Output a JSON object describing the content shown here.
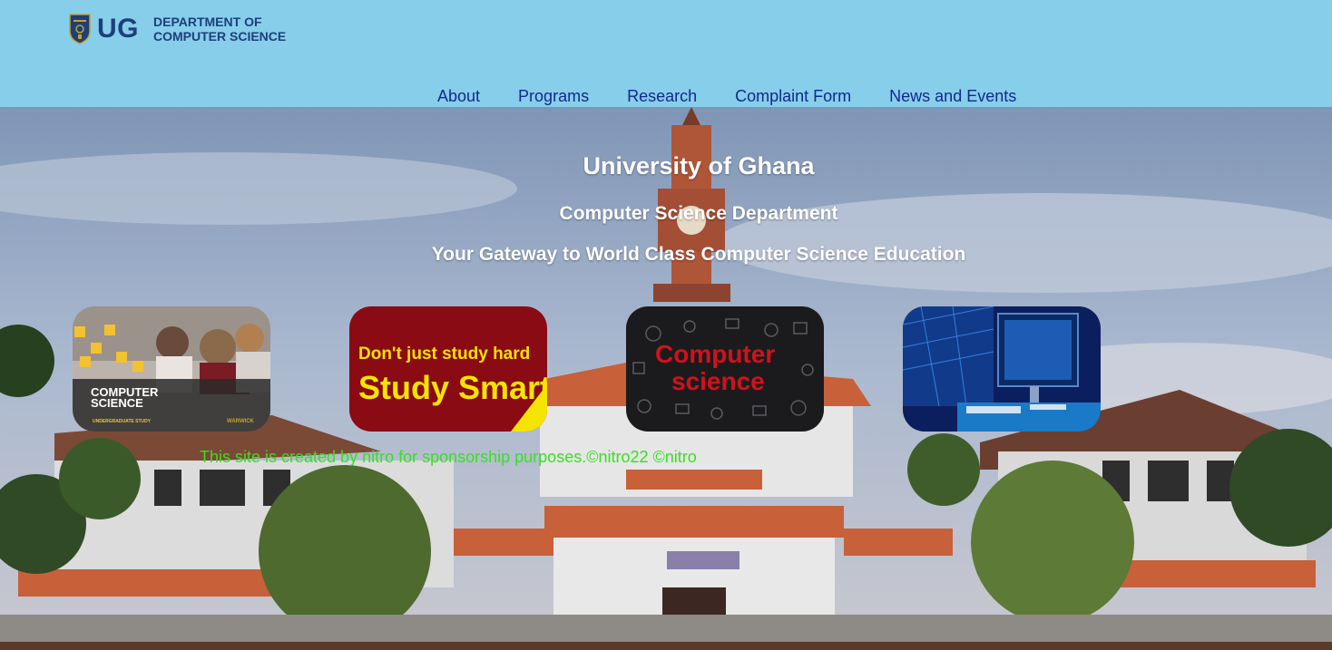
{
  "header": {
    "logo_mark": "UG",
    "dept_line1": "DEPARTMENT OF",
    "dept_line2": "COMPUTER SCIENCE"
  },
  "nav": {
    "items": [
      {
        "label": "About"
      },
      {
        "label": "Programs"
      },
      {
        "label": "Research"
      },
      {
        "label": "Complaint Form"
      },
      {
        "label": "News and Events"
      }
    ]
  },
  "hero": {
    "title": "University of Ghana",
    "subtitle": "Computer Science Department",
    "tagline": "Your Gateway to World Class Computer Science Education"
  },
  "cards": [
    {
      "line1": "COMPUTER",
      "line2": "SCIENCE",
      "line3": "UNDERGRADUATE STUDY",
      "brand": "WARWICK"
    },
    {
      "line1": "Don't just study hard",
      "line2": "Study Smart"
    },
    {
      "line1": "Computer",
      "line2": "science"
    },
    {}
  ],
  "footer": {
    "credit": "This site is created by nitro for sponsorship purposes.©nitro22 ©nitro"
  },
  "colors": {
    "header_bg": "#87ceeb",
    "nav_link": "#112a8c",
    "hero_text": "#ffffff",
    "credit_text": "#35e21d",
    "logo": "#1d3f7a"
  }
}
